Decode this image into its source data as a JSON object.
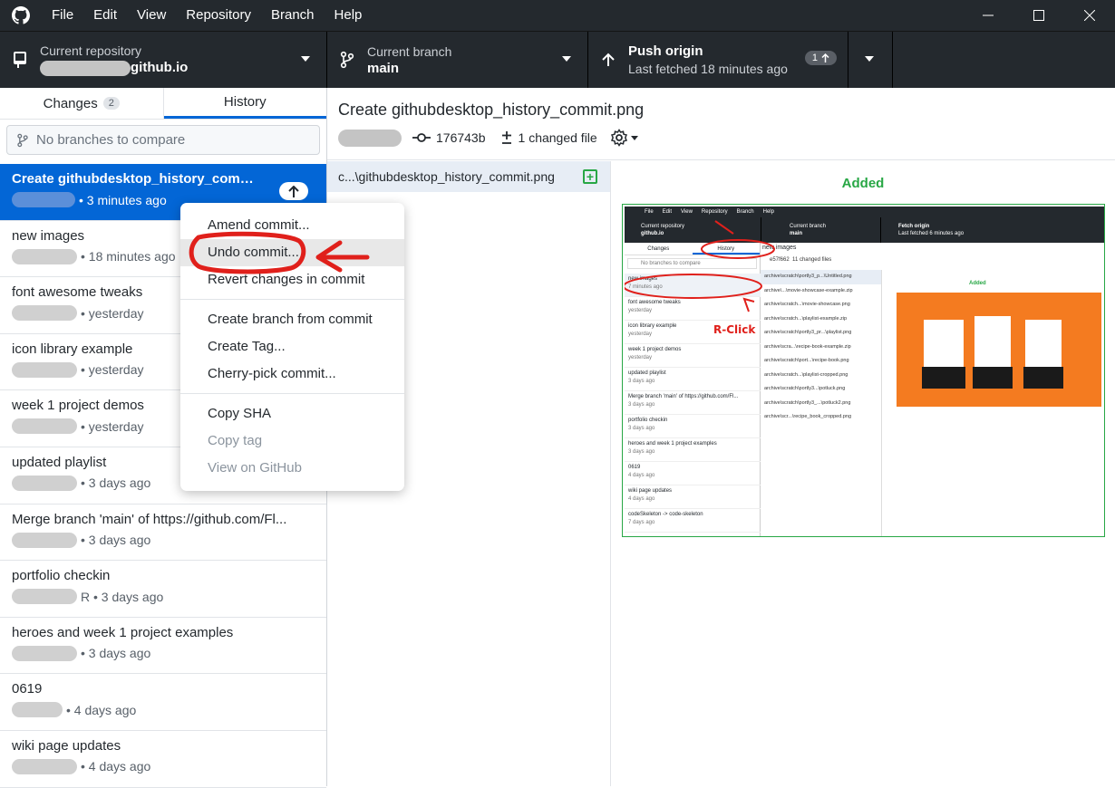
{
  "menu": [
    "File",
    "Edit",
    "View",
    "Repository",
    "Branch",
    "Help"
  ],
  "toolbar": {
    "repo_label": "Current repository",
    "repo_name": "github.io",
    "branch_label": "Current branch",
    "branch_name": "main",
    "push_title": "Push origin",
    "push_sub": "Last fetched 18 minutes ago",
    "push_count": "1"
  },
  "tabs": {
    "changes": "Changes",
    "changes_count": "2",
    "history": "History"
  },
  "compare_placeholder": "No branches to compare",
  "commits": [
    {
      "title": "Create githubdesktop_history_commit.png",
      "time": "3 minutes ago"
    },
    {
      "title": "new images",
      "time": "18 minutes ago"
    },
    {
      "title": "font awesome tweaks",
      "time": "yesterday"
    },
    {
      "title": "icon library example",
      "time": "yesterday"
    },
    {
      "title": "week 1 project demos",
      "time": "yesterday"
    },
    {
      "title": "updated playlist",
      "time": "3 days ago"
    },
    {
      "title": "Merge branch 'main' of https://github.com/Fl...",
      "time": "3 days ago"
    },
    {
      "title": "portfolio checkin",
      "time": "R • 3 days ago"
    },
    {
      "title": "heroes and week 1 project examples",
      "time": "3 days ago"
    },
    {
      "title": "0619",
      "time": "4 days ago"
    },
    {
      "title": "wiki page updates",
      "time": "4 days ago"
    }
  ],
  "detail": {
    "summary": "Create githubdesktop_history_commit.png",
    "sha": "176743b",
    "changed": "1 changed file",
    "file": "c...\\githubdesktop_history_commit.png",
    "added": "Added"
  },
  "context_menu": {
    "amend": "Amend commit...",
    "undo": "Undo commit...",
    "revert": "Revert changes in commit",
    "create_branch": "Create branch from commit",
    "create_tag": "Create Tag...",
    "cherry_pick": "Cherry-pick commit...",
    "copy_sha": "Copy SHA",
    "copy_tag": "Copy tag",
    "view_github": "View on GitHub"
  },
  "thumb": {
    "menu": [
      "File",
      "Edit",
      "View",
      "Repository",
      "Branch",
      "Help"
    ],
    "repo_label": "Current repository",
    "repo_name": "github.io",
    "branch_label": "Current branch",
    "branch_name": "main",
    "fetch_title": "Fetch origin",
    "fetch_sub": "Last fetched 6 minutes ago",
    "tab_changes": "Changes",
    "tab_history": "History",
    "commit_title": "new images",
    "sha": "e57f662",
    "changed": "11 changed files",
    "compare": "No branches to compare",
    "added": "Added",
    "rclick": "R-Click",
    "commits": [
      {
        "title": "new images",
        "time": "7 minutes ago"
      },
      {
        "title": "font awesome tweaks",
        "time": "yesterday"
      },
      {
        "title": "icon library example",
        "time": "yesterday"
      },
      {
        "title": "week 1 project demos",
        "time": "yesterday"
      },
      {
        "title": "updated playlist",
        "time": "3 days ago"
      },
      {
        "title": "Merge branch 'main' of https://github.com/Fl...",
        "time": "3 days ago"
      },
      {
        "title": "portfolio checkin",
        "time": "3 days ago"
      },
      {
        "title": "heroes and week 1 project examples",
        "time": "3 days ago"
      },
      {
        "title": "0619",
        "time": "4 days ago"
      },
      {
        "title": "wiki page updates",
        "time": "4 days ago"
      },
      {
        "title": "codeSkeleton -> code-skeleton",
        "time": "7 days ago"
      }
    ],
    "files": [
      "archive\\scratch\\portly3_p...\\Untitled.png",
      "archive\\...\\movie-showcase-example.zip",
      "archive\\scratch...\\movie-showcase.png",
      "archive\\scratch...\\playlist-example.zip",
      "archive\\scratch\\portly3_pr...\\playlist.png",
      "archive\\scra...\\recipe-book-example.zip",
      "archive\\scratch\\port...\\recipe-book.png",
      "archive\\scratch...\\playlist-cropped.png",
      "archive\\scratch\\portly3...\\potluck.png",
      "archive\\scratch\\portly3_...\\potluck2.png",
      "archive\\scr...\\recipe_book_cropped.png"
    ]
  },
  "colors": {
    "accent": "#0366d6",
    "added": "#28a745",
    "annotation": "#e0201b",
    "preview_bg": "#f47b20"
  }
}
